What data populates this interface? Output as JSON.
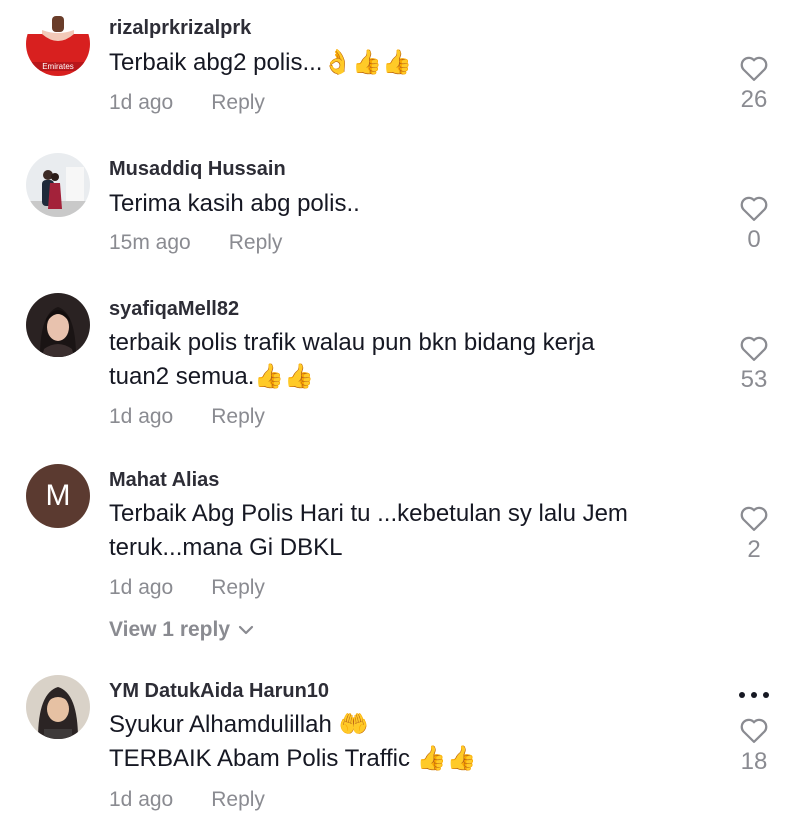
{
  "comments": [
    {
      "username": "rizalprkrizalprk",
      "text": "Terbaik abg2 polis...👌👍👍",
      "time": "1d ago",
      "reply_label": "Reply",
      "likes": "26",
      "avatar_text": "Emirates"
    },
    {
      "username": "Musaddiq Hussain",
      "text": "Terima kasih abg polis..",
      "time": "15m ago",
      "reply_label": "Reply",
      "likes": "0"
    },
    {
      "username": "syafiqaMell82",
      "text": "terbaik polis trafik walau pun bkn bidang kerja\ntuan2 semua.👍👍",
      "time": "1d ago",
      "reply_label": "Reply",
      "likes": "53"
    },
    {
      "username": "Mahat Alias",
      "text": "Terbaik Abg Polis Hari tu ...kebetulan sy lalu Jem\nteruk...mana Gi DBKL",
      "time": "1d ago",
      "reply_label": "Reply",
      "likes": "2",
      "avatar_letter": "M",
      "view_replies": "View 1 reply"
    },
    {
      "username": "YM DatukAida Harun10",
      "text": "Syukur Alhamdulillah 🤲\nTERBAIK Abam Polis Traffic 👍👍",
      "time": "1d ago",
      "reply_label": "Reply",
      "likes": "18"
    }
  ],
  "colors": {
    "primary_text": "#161823",
    "secondary_text": "#8a8b91",
    "avatar_letter_bg": "#5b3a30"
  },
  "icons": {
    "like": "heart-outline-icon",
    "more": "more-dots-icon",
    "expand": "chevron-down-icon"
  }
}
